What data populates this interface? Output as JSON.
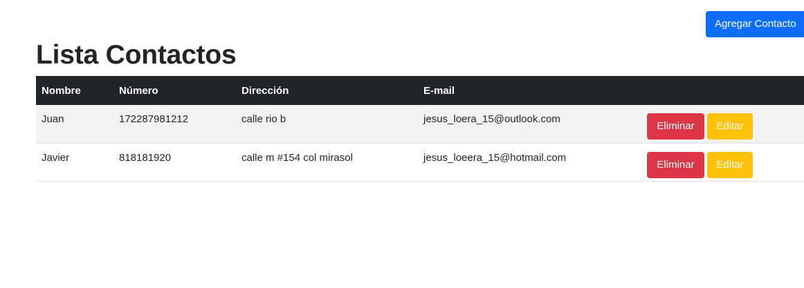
{
  "header": {
    "add_button_label": "Agregar Contacto",
    "title": "Lista Contactos"
  },
  "table": {
    "columns": [
      "Nombre",
      "Número",
      "Dirección",
      "E-mail",
      ""
    ],
    "rows": [
      {
        "nombre": "Juan",
        "numero": "172287981212",
        "direccion": "calle rio b",
        "email": "jesus_loera_15@outlook.com",
        "delete_label": "Eliminar",
        "edit_label": "Editar"
      },
      {
        "nombre": "Javier",
        "numero": "818181920",
        "direccion": "calle m #154 col mirasol",
        "email": "jesus_loeera_15@hotmail.com",
        "delete_label": "Eliminar",
        "edit_label": "Editar"
      }
    ]
  },
  "colors": {
    "primary": "#0d6efd",
    "danger": "#dc3545",
    "warning": "#ffc107",
    "table_header": "#212529",
    "stripe": "#f2f2f2"
  }
}
